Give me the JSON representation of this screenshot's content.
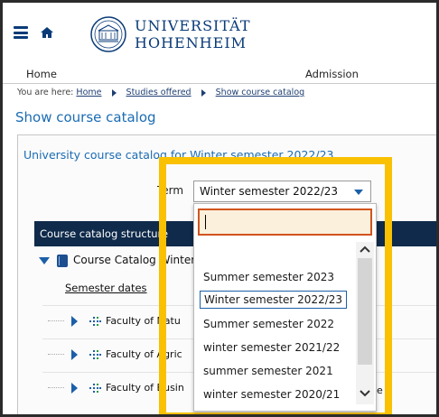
{
  "header": {
    "logo_line1": "UNIVERSITÄT",
    "logo_line2": "HOHENHEIM",
    "menu_icon": "hamburger-menu-icon",
    "home_icon": "home-icon",
    "seal_icon": "university-seal-icon"
  },
  "nav": {
    "home": "Home",
    "admission": "Admission"
  },
  "breadcrumb": {
    "prefix": "You are here:",
    "items": [
      "Home",
      "Studies offered",
      "Show course catalog"
    ]
  },
  "page_title": "Show course catalog",
  "panel": {
    "title": "University course catalog for Winter semester 2022/23"
  },
  "term": {
    "label": "Term",
    "selected": "Winter semester 2022/23"
  },
  "structure": {
    "header": "Course catalog structure",
    "root_label": "Course Catalog Winter",
    "semester_dates": "Semester dates",
    "rows": [
      "Faculty of Natu",
      "Faculty of Agric",
      "Faculty of Busin"
    ],
    "trailing_letter": "e"
  },
  "dropdown": {
    "search_value": "",
    "options": [
      "Summer semester 2023",
      "Winter semester 2022/23",
      "Summer semester 2022",
      "winter semester 2021/22",
      "summer semester 2021",
      "winter semester 2020/21"
    ],
    "selected_index": 1
  },
  "colors": {
    "brand_blue": "#0a3b78",
    "link_blue": "#1b6cb3",
    "highlight": "#f9c102",
    "search_border": "#d1541e",
    "structure_header": "#0f2a4a"
  }
}
